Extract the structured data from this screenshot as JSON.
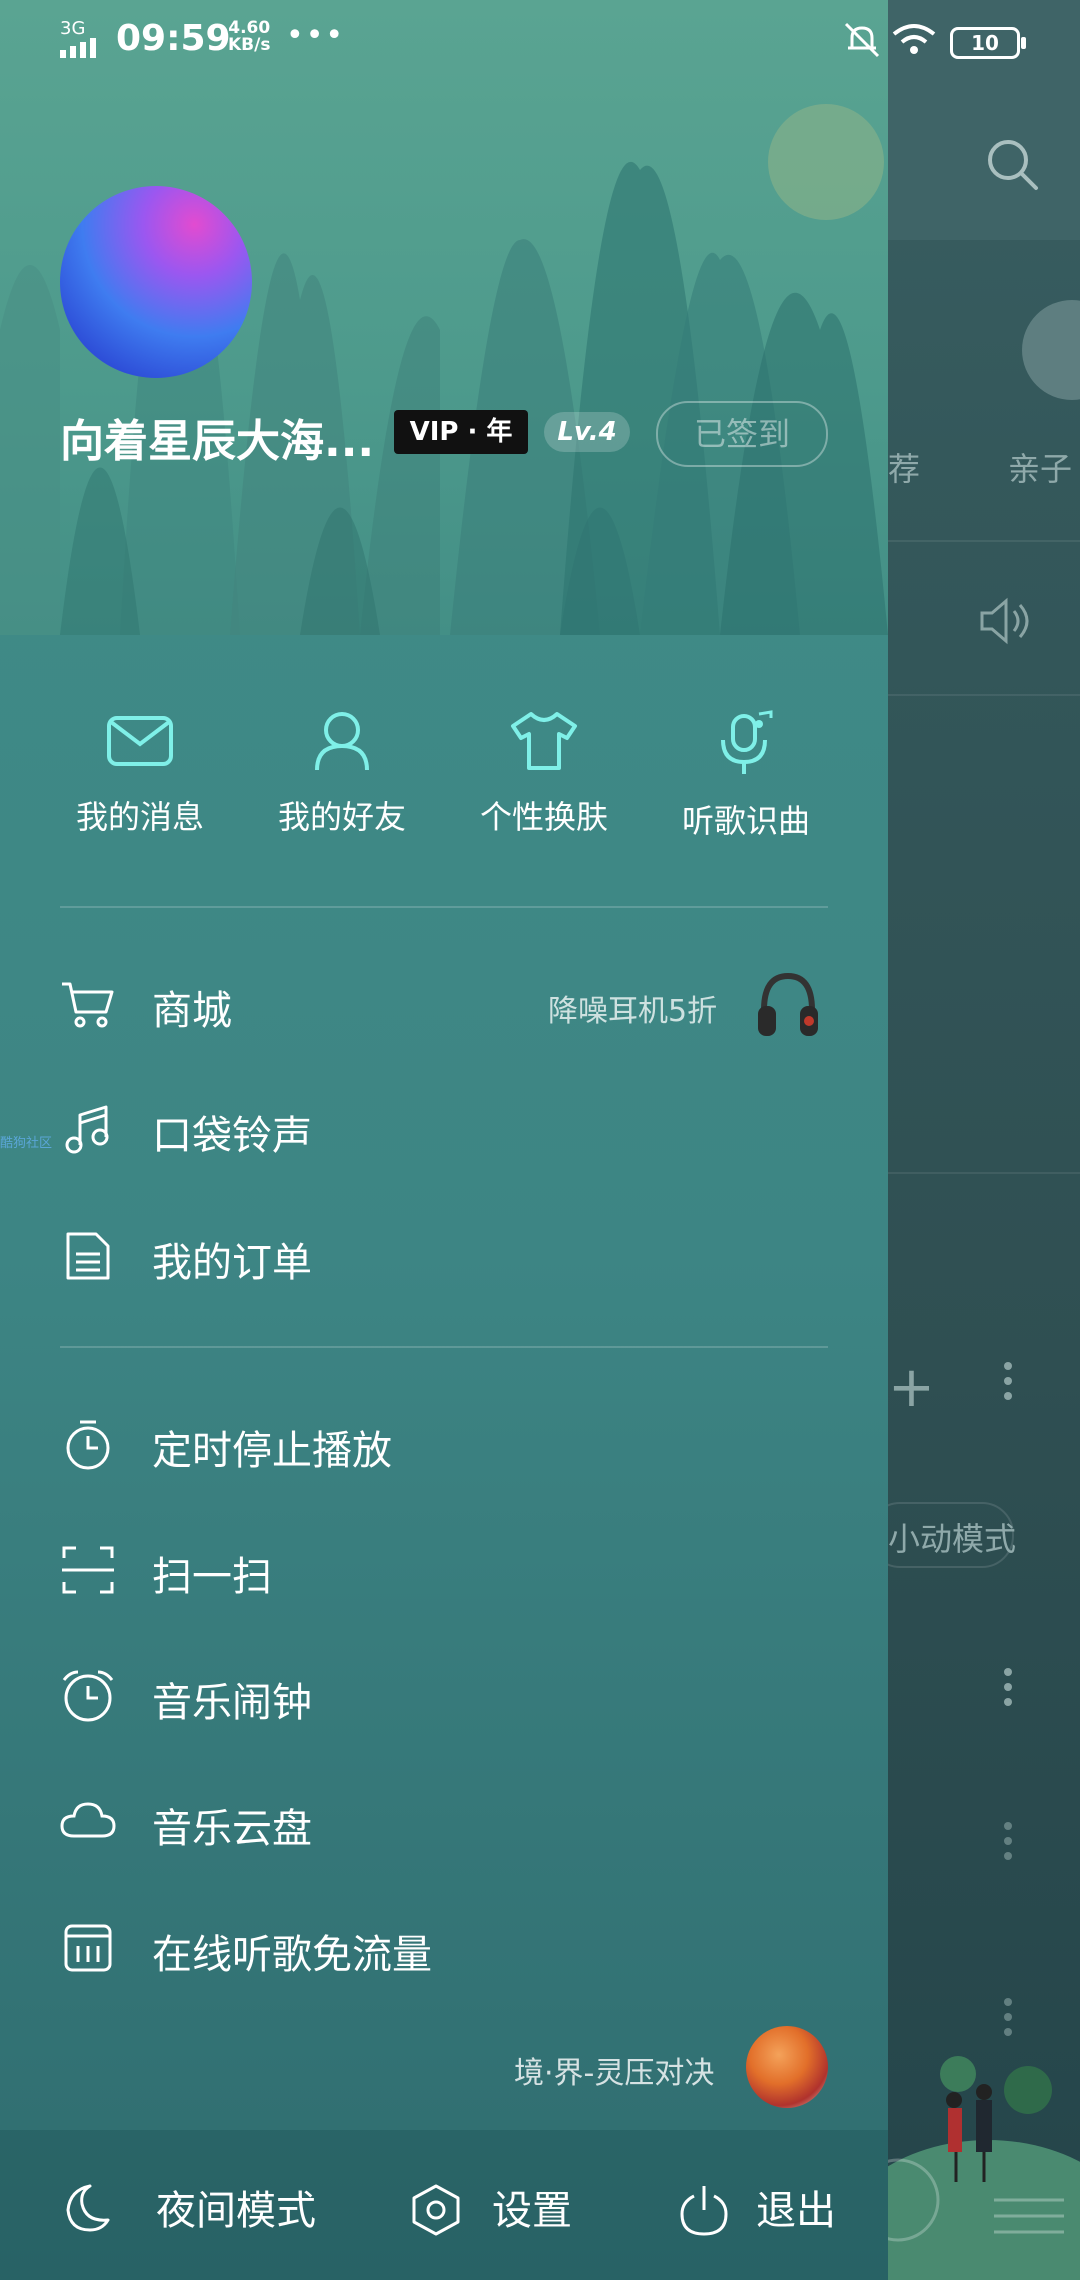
{
  "status_bar": {
    "network": "3G",
    "time": "09:59",
    "speed_value": "4.60",
    "speed_unit": "KB/s",
    "more": "•••",
    "battery": "10"
  },
  "profile": {
    "username": "向着星辰大海...",
    "vip_badge": "VIP · 年",
    "level": "Lv.4",
    "checkin_label": "已签到"
  },
  "quick_actions": [
    {
      "label": "我的消息",
      "icon": "mail-icon"
    },
    {
      "label": "我的好友",
      "icon": "person-icon"
    },
    {
      "label": "个性换肤",
      "icon": "tshirt-icon"
    },
    {
      "label": "听歌识曲",
      "icon": "mic-music-icon"
    }
  ],
  "menu_group_1": [
    {
      "label": "商城",
      "icon": "cart-icon",
      "promo": "降噪耳机5折"
    },
    {
      "label": "口袋铃声",
      "icon": "music-note-icon"
    },
    {
      "label": "我的订单",
      "icon": "document-icon"
    }
  ],
  "side_link": "酷狗社区",
  "menu_group_2": [
    {
      "label": "定时停止播放",
      "icon": "timer-icon"
    },
    {
      "label": "扫一扫",
      "icon": "scan-icon"
    },
    {
      "label": "音乐闹钟",
      "icon": "alarm-icon"
    },
    {
      "label": "音乐云盘",
      "icon": "cloud-icon"
    },
    {
      "label": "在线听歌免流量",
      "icon": "sim-card-icon"
    }
  ],
  "now_playing": "境·界-灵压对决",
  "bottom_bar": {
    "night_mode": "夜间模式",
    "settings": "设置",
    "logout": "退出"
  },
  "background_fragments": {
    "recommend_fragment": "荐",
    "kids_fragment": "亲子",
    "mode_fragment": "小动模式"
  },
  "colors": {
    "icon_accent": "#7ff0e8",
    "drawer_top": "#4e9b92",
    "drawer_bottom": "#2f6c6f"
  }
}
